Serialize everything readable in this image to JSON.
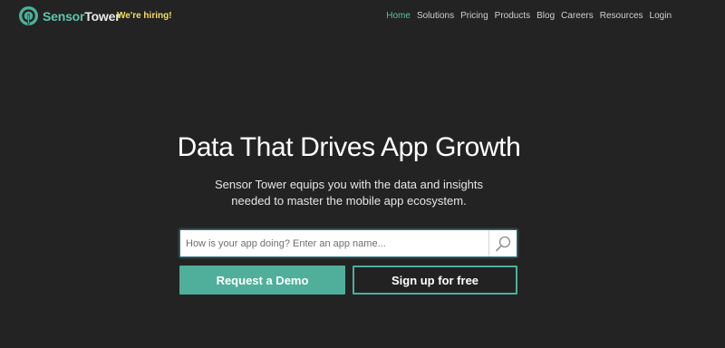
{
  "header": {
    "logo": {
      "sensor": "Sensor",
      "tower": "Tower",
      "icon": "sensortower-logo-icon"
    },
    "hiring": "We're hiring!",
    "nav": [
      {
        "label": "Home",
        "active": true
      },
      {
        "label": "Solutions",
        "active": false
      },
      {
        "label": "Pricing",
        "active": false
      },
      {
        "label": "Products",
        "active": false
      },
      {
        "label": "Blog",
        "active": false
      },
      {
        "label": "Careers",
        "active": false
      },
      {
        "label": "Resources",
        "active": false
      },
      {
        "label": "Login",
        "active": false
      }
    ]
  },
  "hero": {
    "title": "Data That Drives App Growth",
    "subtitle_line1": "Sensor Tower equips you with the data and insights",
    "subtitle_line2": "needed to master the mobile app ecosystem."
  },
  "search": {
    "placeholder": "How is your app doing? Enter an app name...",
    "value": "",
    "icon": "search-icon"
  },
  "buttons": {
    "demo": "Request a Demo",
    "signup": "Sign up for free"
  },
  "colors": {
    "background": "#232323",
    "accent": "#4faf9a",
    "nav_active": "#55c1ab",
    "hiring": "#f2df68"
  }
}
